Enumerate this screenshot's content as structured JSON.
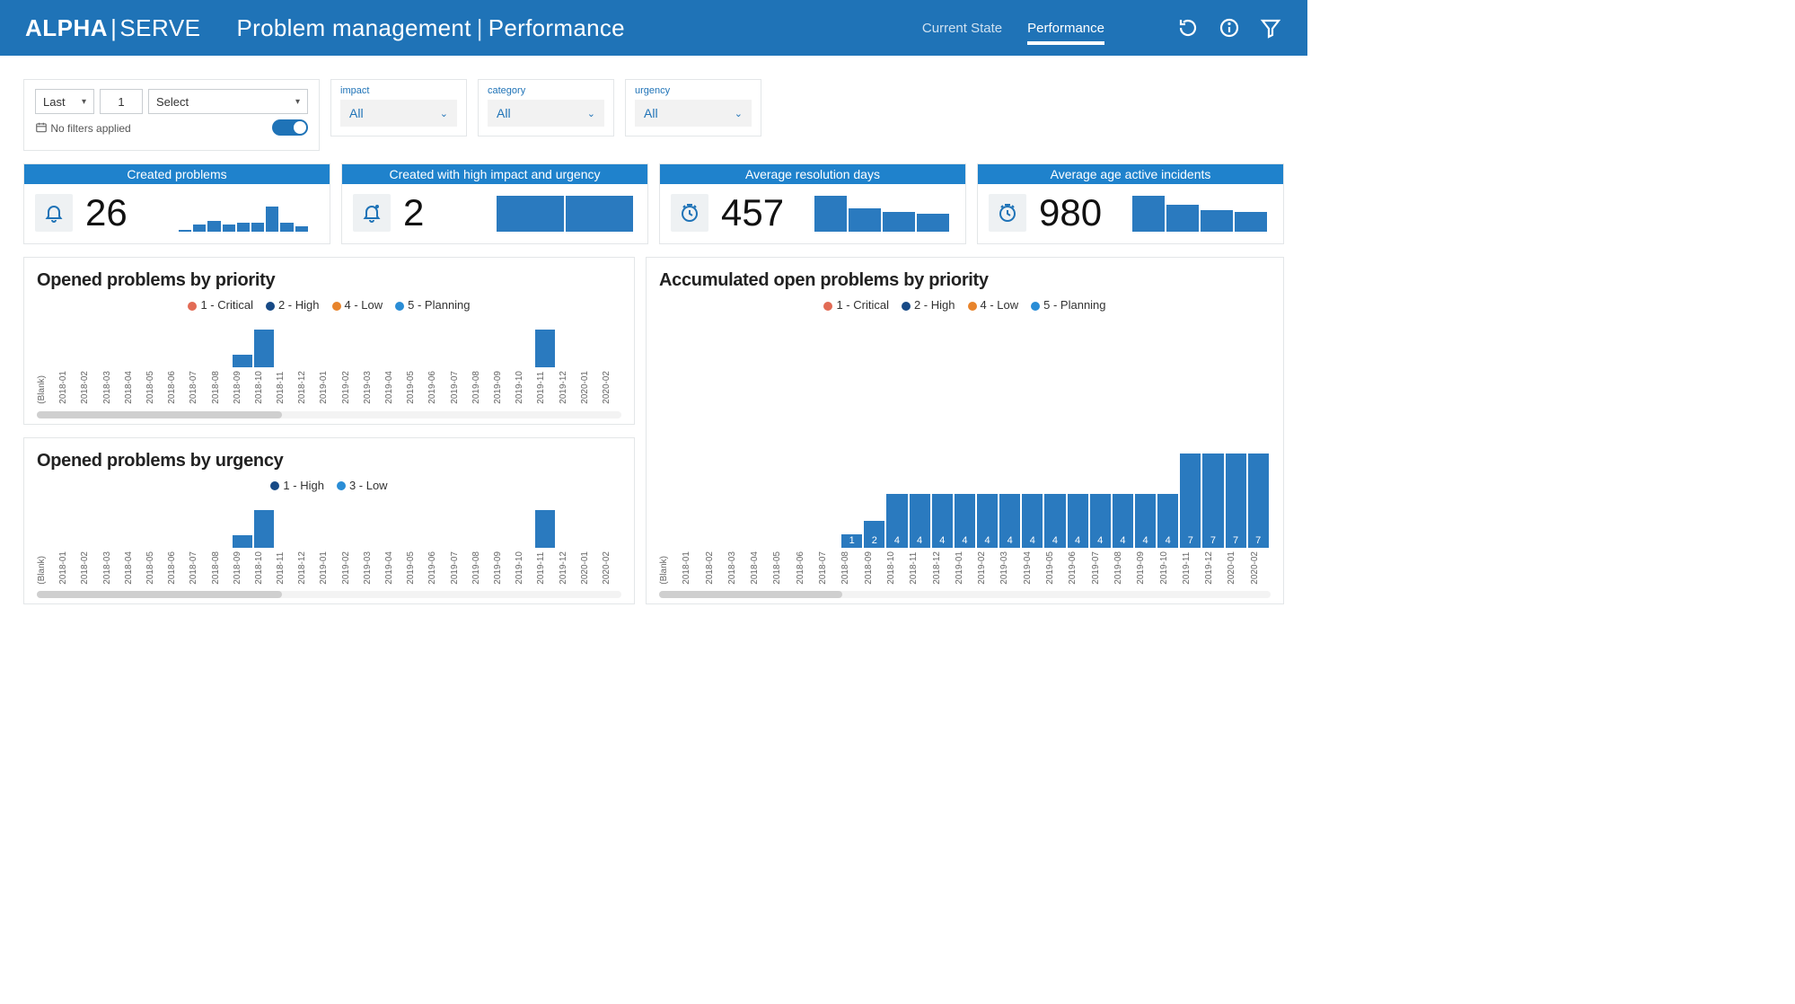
{
  "brand": {
    "a": "ALPHA",
    "b": "SERVE"
  },
  "page_title": {
    "a": "Problem management",
    "b": "Performance"
  },
  "tabs": [
    {
      "label": "Current State",
      "active": false
    },
    {
      "label": "Performance",
      "active": true
    }
  ],
  "filter": {
    "last": "Last",
    "count": "1",
    "select": "Select",
    "no_filters": "No filters applied"
  },
  "pill_filters": [
    {
      "label": "impact",
      "value": "All"
    },
    {
      "label": "category",
      "value": "All"
    },
    {
      "label": "urgency",
      "value": "All"
    }
  ],
  "kpi": [
    {
      "title": "Created problems",
      "value": "26",
      "icon": "bell",
      "spark": [
        2,
        8,
        12,
        8,
        10,
        10,
        28,
        10,
        6
      ]
    },
    {
      "title": "Created with high impact and urgency",
      "value": "2",
      "icon": "bell-alert",
      "spark": [
        40,
        40
      ]
    },
    {
      "title": "Average resolution days",
      "value": "457",
      "icon": "clock",
      "spark": [
        40,
        26,
        22,
        20
      ]
    },
    {
      "title": "Average age active incidents",
      "value": "980",
      "icon": "clock",
      "spark": [
        40,
        30,
        24,
        22
      ]
    }
  ],
  "chart_priority_legend": [
    {
      "color": "#e26b55",
      "label": "1 - Critical"
    },
    {
      "color": "#174a86",
      "label": "2 - High"
    },
    {
      "color": "#e8842c",
      "label": "4 - Low"
    },
    {
      "color": "#2a8dd6",
      "label": "5 - Planning"
    }
  ],
  "chart_urgency_legend": [
    {
      "color": "#174a86",
      "label": "1 - High"
    },
    {
      "color": "#2a8dd6",
      "label": "3 - Low"
    }
  ],
  "months": [
    "(Blank)",
    "2018-01",
    "2018-02",
    "2018-03",
    "2018-04",
    "2018-05",
    "2018-06",
    "2018-07",
    "2018-08",
    "2018-09",
    "2018-10",
    "2018-11",
    "2018-12",
    "2019-01",
    "2019-02",
    "2019-03",
    "2019-04",
    "2019-05",
    "2019-06",
    "2019-07",
    "2019-08",
    "2019-09",
    "2019-10",
    "2019-11",
    "2019-12",
    "2020-01",
    "2020-02"
  ],
  "chart_data": [
    {
      "type": "bar",
      "title": "Opened problems by priority",
      "categories": [
        "(Blank)",
        "2018-01",
        "2018-02",
        "2018-03",
        "2018-04",
        "2018-05",
        "2018-06",
        "2018-07",
        "2018-08",
        "2018-09",
        "2018-10",
        "2018-11",
        "2018-12",
        "2019-01",
        "2019-02",
        "2019-03",
        "2019-04",
        "2019-05",
        "2019-06",
        "2019-07",
        "2019-08",
        "2019-09",
        "2019-10",
        "2019-11",
        "2019-12",
        "2020-01",
        "2020-02"
      ],
      "values": [
        0,
        0,
        0,
        0,
        0,
        0,
        0,
        0,
        0,
        1,
        3,
        0,
        0,
        0,
        0,
        0,
        0,
        0,
        0,
        0,
        0,
        0,
        0,
        3,
        0,
        0,
        0
      ],
      "ylim": [
        0,
        4
      ]
    },
    {
      "type": "bar",
      "title": "Opened problems by urgency",
      "categories": [
        "(Blank)",
        "2018-01",
        "2018-02",
        "2018-03",
        "2018-04",
        "2018-05",
        "2018-06",
        "2018-07",
        "2018-08",
        "2018-09",
        "2018-10",
        "2018-11",
        "2018-12",
        "2019-01",
        "2019-02",
        "2019-03",
        "2019-04",
        "2019-05",
        "2019-06",
        "2019-07",
        "2019-08",
        "2019-09",
        "2019-10",
        "2019-11",
        "2019-12",
        "2020-01",
        "2020-02"
      ],
      "values": [
        0,
        0,
        0,
        0,
        0,
        0,
        0,
        0,
        0,
        1,
        3,
        0,
        0,
        0,
        0,
        0,
        0,
        0,
        0,
        0,
        0,
        0,
        0,
        3,
        0,
        0,
        0
      ],
      "ylim": [
        0,
        4
      ]
    },
    {
      "type": "bar",
      "title": "Accumulated open problems by priority",
      "categories": [
        "(Blank)",
        "2018-01",
        "2018-02",
        "2018-03",
        "2018-04",
        "2018-05",
        "2018-06",
        "2018-07",
        "2018-08",
        "2018-09",
        "2018-10",
        "2018-11",
        "2018-12",
        "2019-01",
        "2019-02",
        "2019-03",
        "2019-04",
        "2019-05",
        "2019-06",
        "2019-07",
        "2019-08",
        "2019-09",
        "2019-10",
        "2019-11",
        "2019-12",
        "2020-01",
        "2020-02"
      ],
      "values": [
        0,
        0,
        0,
        0,
        0,
        0,
        0,
        0,
        1,
        2,
        4,
        4,
        4,
        4,
        4,
        4,
        4,
        4,
        4,
        4,
        4,
        4,
        4,
        7,
        7,
        7,
        7
      ],
      "ylim": [
        0,
        8
      ]
    }
  ],
  "titles": {
    "opened_priority": "Opened problems by priority",
    "opened_urgency": "Opened problems by urgency",
    "accumulated": "Accumulated open problems by priority"
  }
}
